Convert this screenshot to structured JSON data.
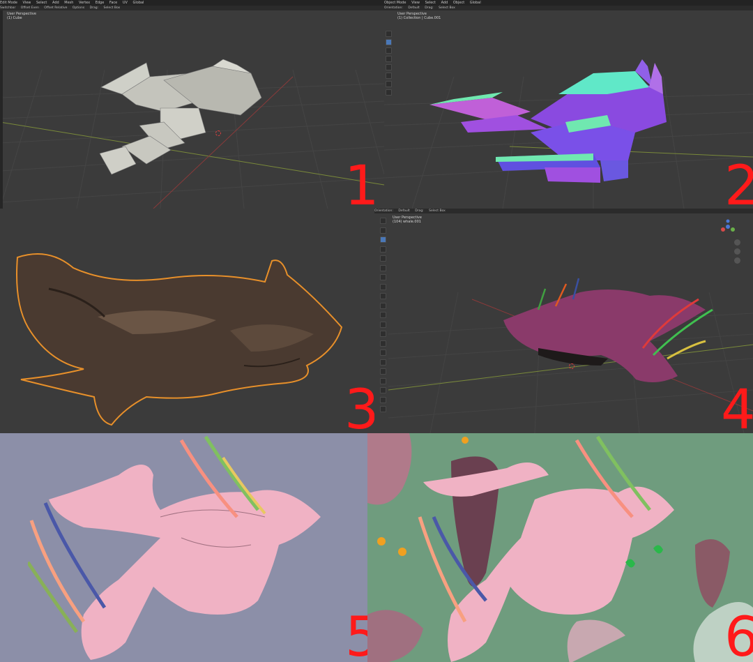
{
  "panels": {
    "p1": {
      "number": "1",
      "topbar": [
        "Edit Mode",
        "View",
        "Select",
        "Add",
        "Mesh",
        "Vertex",
        "Edge",
        "Face",
        "UV",
        "Global"
      ],
      "toolbar": [
        "Switchbar",
        "Offset Even",
        "Offset Relative",
        "Options",
        "Drag:",
        "Select Box"
      ],
      "view_label": "User Perspective",
      "object_label": "(1) Cube"
    },
    "p2": {
      "number": "2",
      "topbar": [
        "Object Mode",
        "View",
        "Select",
        "Add",
        "Object",
        "Global"
      ],
      "toolbar": [
        "Orientation:",
        "Default",
        "Drag:",
        "Select Box"
      ],
      "view_label": "User Perspective",
      "object_label": "(1) Collection | Cube.001"
    },
    "p3": {
      "number": "3"
    },
    "p4": {
      "number": "4",
      "toolbar": [
        "Orientation:",
        "Default",
        "Drag:",
        "Select Box"
      ],
      "view_label": "User Perspective",
      "object_label": "(104) whale.001"
    },
    "p5": {
      "number": "5"
    },
    "p6": {
      "number": "6"
    }
  },
  "colors": {
    "number": "#ff1a1a",
    "viewport_bg": "#3b3b3b",
    "render5_bg": "#8c8fa8",
    "render6_bg": "#6f9c7e",
    "whale_pink": "#f0b2c4",
    "sculpt_brown": "#4a3a30",
    "selection_outline": "#e8902a"
  }
}
